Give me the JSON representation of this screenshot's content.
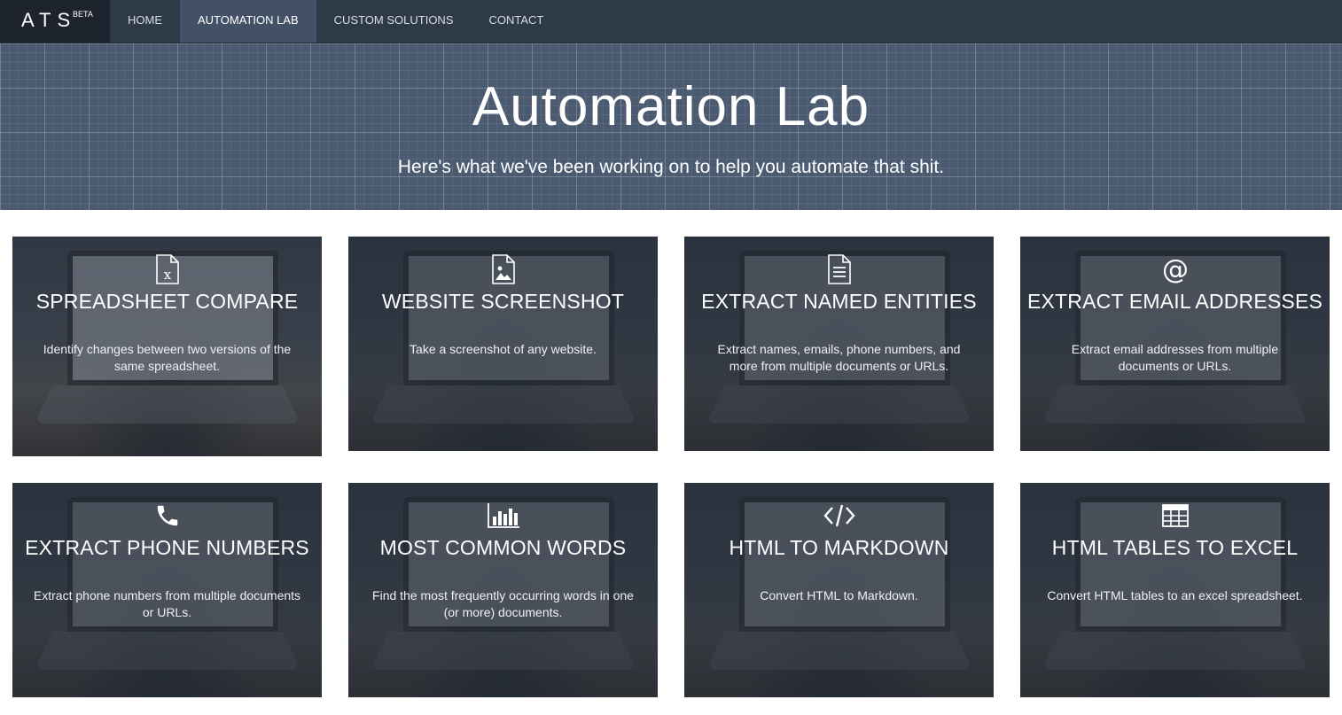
{
  "brand": {
    "name": "ATS",
    "badge": "BETA"
  },
  "nav": [
    {
      "label": "HOME",
      "active": false
    },
    {
      "label": "AUTOMATION LAB",
      "active": true
    },
    {
      "label": "CUSTOM SOLUTIONS",
      "active": false
    },
    {
      "label": "CONTACT",
      "active": false
    }
  ],
  "hero": {
    "title": "Automation Lab",
    "subtitle": "Here's what we've been working on to help you automate that shit."
  },
  "cards": [
    {
      "icon": "excel-file-icon",
      "title": "SPREADSHEET COMPARE",
      "description": "Identify changes between two versions of the same spreadsheet."
    },
    {
      "icon": "image-file-icon",
      "title": "WEBSITE SCREENSHOT",
      "description": "Take a screenshot of any website."
    },
    {
      "icon": "text-file-icon",
      "title": "EXTRACT NAMED ENTITIES",
      "description": "Extract names, emails, phone numbers, and more from multiple documents or URLs."
    },
    {
      "icon": "at-sign-icon",
      "title": "EXTRACT EMAIL ADDRESSES",
      "description": "Extract email addresses from multiple documents or URLs."
    },
    {
      "icon": "phone-icon",
      "title": "EXTRACT PHONE NUMBERS",
      "description": "Extract phone numbers from multiple documents or URLs."
    },
    {
      "icon": "bar-chart-icon",
      "title": "MOST COMMON WORDS",
      "description": "Find the most frequently occurring words in one (or more) documents."
    },
    {
      "icon": "code-icon",
      "title": "HTML TO MARKDOWN",
      "description": "Convert HTML to Markdown."
    },
    {
      "icon": "table-icon",
      "title": "HTML TABLES TO EXCEL",
      "description": "Convert HTML tables to an excel spreadsheet."
    }
  ],
  "colors": {
    "navbar": "#2f3a49",
    "brand_bg": "#1d242e",
    "nav_active": "#435166",
    "hero": "#4a5a70"
  }
}
